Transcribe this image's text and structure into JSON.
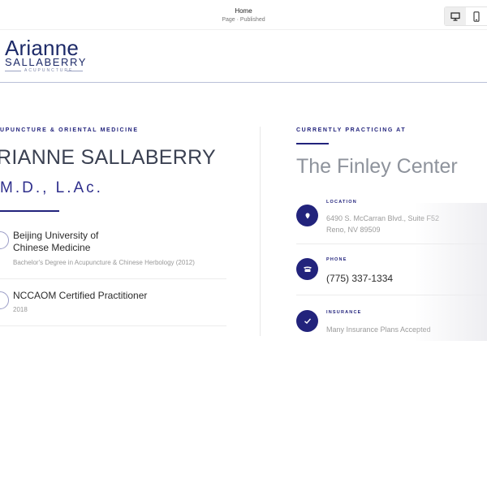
{
  "editor": {
    "page_title": "Home",
    "page_status": "Page · Published",
    "device_desktop_icon": "desktop-icon",
    "device_mobile_icon": "mobile-icon"
  },
  "logo": {
    "name": "Arianne",
    "surname": "SALLABERRY",
    "tagline": "ACUPUNCTURE"
  },
  "left": {
    "eyebrow": "UPUNCTURE & ORIENTAL MEDICINE",
    "name": "RIANNE SALLABERRY",
    "credentials": "M.D., L.Ac.",
    "education": [
      {
        "title_line1": "Beijing University of",
        "title_line2": "Chinese Medicine",
        "subtitle": "Bachelor's Degree in Acupuncture & Chinese Herbology (2012)"
      },
      {
        "title_line1": "NCCAOM Certified Practitioner",
        "subtitle": "2018"
      }
    ]
  },
  "right": {
    "eyebrow": "CURRENTLY PRACTICING AT",
    "center_name": "The Finley Center",
    "items": [
      {
        "label": "LOCATION",
        "line1": "6490 S. McCarran Blvd., Suite F52",
        "line2": "Reno, NV 89509",
        "icon": "location-icon"
      },
      {
        "label": "PHONE",
        "value": "(775) 337-1334",
        "icon": "phone-icon"
      },
      {
        "label": "INSURANCE",
        "value": "Many Insurance Plans Accepted",
        "icon": "check-icon"
      }
    ]
  },
  "colors": {
    "accent": "#22237c",
    "logo": "#1d2a68",
    "muted_heading": "#8e939c"
  }
}
